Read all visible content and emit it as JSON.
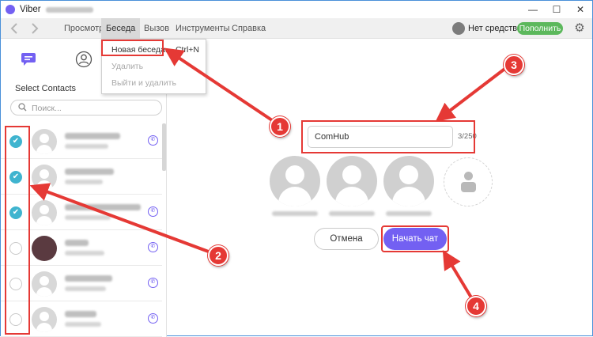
{
  "window": {
    "title": "Viber",
    "minimize_symbol": "—",
    "maximize_symbol": "☐",
    "close_symbol": "✕"
  },
  "menu": {
    "items": [
      "Просмотр",
      "Беседа",
      "Вызов",
      "Инструменты",
      "Справка"
    ],
    "active": "Беседа",
    "balance": "Нет средств",
    "topup": "Пополнить"
  },
  "dropdown": {
    "items": [
      {
        "label": "Новая беседа...",
        "shortcut": "Ctrl+N",
        "enabled": true
      },
      {
        "label": "Удалить",
        "shortcut": "",
        "enabled": false
      },
      {
        "label": "Выйти и удалить",
        "shortcut": "",
        "enabled": false
      }
    ]
  },
  "sidebar": {
    "tabs": [
      "chat-bubble-icon",
      "person-icon"
    ],
    "title": "Select Contacts",
    "search_placeholder": "Поиск...",
    "contacts": [
      {
        "checked": true
      },
      {
        "checked": true
      },
      {
        "checked": true
      },
      {
        "checked": false
      },
      {
        "checked": false
      },
      {
        "checked": false
      }
    ]
  },
  "chat": {
    "name_value": "ComHub",
    "counter": "3/250",
    "cancel": "Отмена",
    "start": "Начать чат"
  },
  "annotations": {
    "badges": [
      "1",
      "2",
      "3",
      "4"
    ]
  },
  "colors": {
    "accent": "#7360f2",
    "check": "#3fb4cf",
    "topup": "#5cb85c",
    "annotation": "#e53935"
  }
}
